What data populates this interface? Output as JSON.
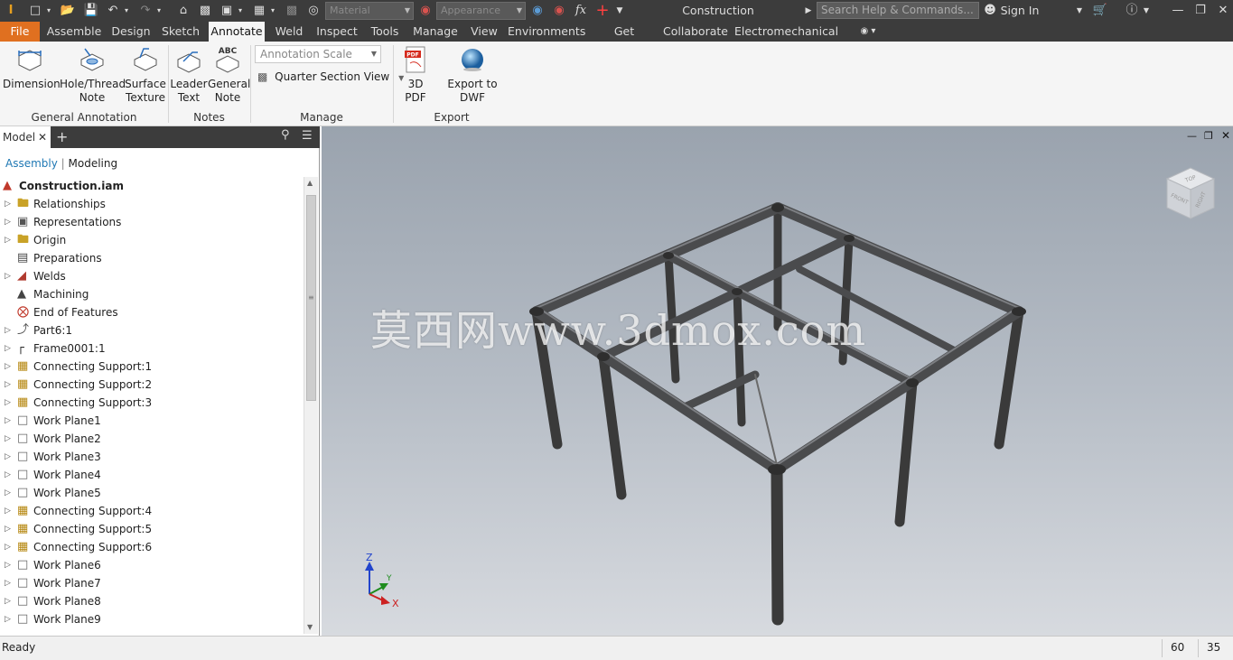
{
  "titlebar": {
    "material_placeholder": "Material",
    "appearance_placeholder": "Appearance",
    "doc_title": "Construction",
    "search_placeholder": "Search Help & Commands...",
    "sign_in": "Sign In",
    "fx": "fx"
  },
  "tabs": [
    "File",
    "Assemble",
    "Design",
    "Sketch",
    "Annotate",
    "Weld",
    "Inspect",
    "Tools",
    "Manage",
    "View",
    "Environments",
    "Get Started",
    "Collaborate",
    "Electromechanical"
  ],
  "active_tab": "Annotate",
  "ribbon": {
    "dimension": "Dimension",
    "hole_thread_1": "Hole/Thread",
    "hole_thread_2": "Note",
    "surface_1": "Surface",
    "surface_2": "Texture",
    "leader_1": "Leader",
    "leader_2": "Text",
    "general_1": "General",
    "general_2": "Note",
    "annotation_scale": "Annotation Scale",
    "quarter_section": "Quarter Section View",
    "pdf3d": "3D PDF",
    "export_dwf": "Export to DWF",
    "group_general_annotation": "General Annotation",
    "group_notes": "Notes",
    "group_manage": "Manage",
    "group_export": "Export",
    "general_note_icon_text": "ABC",
    "pdf_icon_text": "PDF"
  },
  "browser": {
    "tab_label": "Model",
    "sub_assembly": "Assembly",
    "sub_modeling": "Modeling",
    "tree": [
      {
        "label": "Construction.iam",
        "icon": "assembly-icon",
        "root": true
      },
      {
        "label": "Relationships",
        "icon": "folder-icon"
      },
      {
        "label": "Representations",
        "icon": "representations-icon"
      },
      {
        "label": "Origin",
        "icon": "folder-icon"
      },
      {
        "label": "Preparations",
        "icon": "preparations-icon"
      },
      {
        "label": "Welds",
        "icon": "welds-icon"
      },
      {
        "label": "Machining",
        "icon": "machining-icon"
      },
      {
        "label": "End of Features",
        "icon": "end-of-features-icon"
      },
      {
        "label": "Part6:1",
        "icon": "part-icon"
      },
      {
        "label": "Frame0001:1",
        "icon": "frame-icon"
      },
      {
        "label": "Connecting Support:1",
        "icon": "connecting-support-icon"
      },
      {
        "label": "Connecting Support:2",
        "icon": "connecting-support-icon"
      },
      {
        "label": "Connecting Support:3",
        "icon": "connecting-support-icon"
      },
      {
        "label": "Work Plane1",
        "icon": "work-plane-icon"
      },
      {
        "label": "Work Plane2",
        "icon": "work-plane-icon"
      },
      {
        "label": "Work Plane3",
        "icon": "work-plane-icon"
      },
      {
        "label": "Work Plane4",
        "icon": "work-plane-icon"
      },
      {
        "label": "Work Plane5",
        "icon": "work-plane-icon"
      },
      {
        "label": "Connecting Support:4",
        "icon": "connecting-support-icon"
      },
      {
        "label": "Connecting Support:5",
        "icon": "connecting-support-icon"
      },
      {
        "label": "Connecting Support:6",
        "icon": "connecting-support-icon"
      },
      {
        "label": "Work Plane6",
        "icon": "work-plane-icon"
      },
      {
        "label": "Work Plane7",
        "icon": "work-plane-icon"
      },
      {
        "label": "Work Plane8",
        "icon": "work-plane-icon"
      },
      {
        "label": "Work Plane9",
        "icon": "work-plane-icon"
      }
    ]
  },
  "viewport": {
    "watermark": "莫西网www.3dmox.com",
    "viewcube_front": "FRONT",
    "viewcube_right": "RIGHT",
    "viewcube_top": "TOP",
    "axis_x": "X",
    "axis_y": "Y",
    "axis_z": "Z"
  },
  "status": {
    "text": "Ready",
    "count1": "60",
    "count2": "35"
  },
  "colors": {
    "file_tab": "#e07020",
    "dark_bar": "#3c3c3c",
    "ribbon_bg": "#f5f5f5",
    "link_blue": "#1f78b4"
  }
}
